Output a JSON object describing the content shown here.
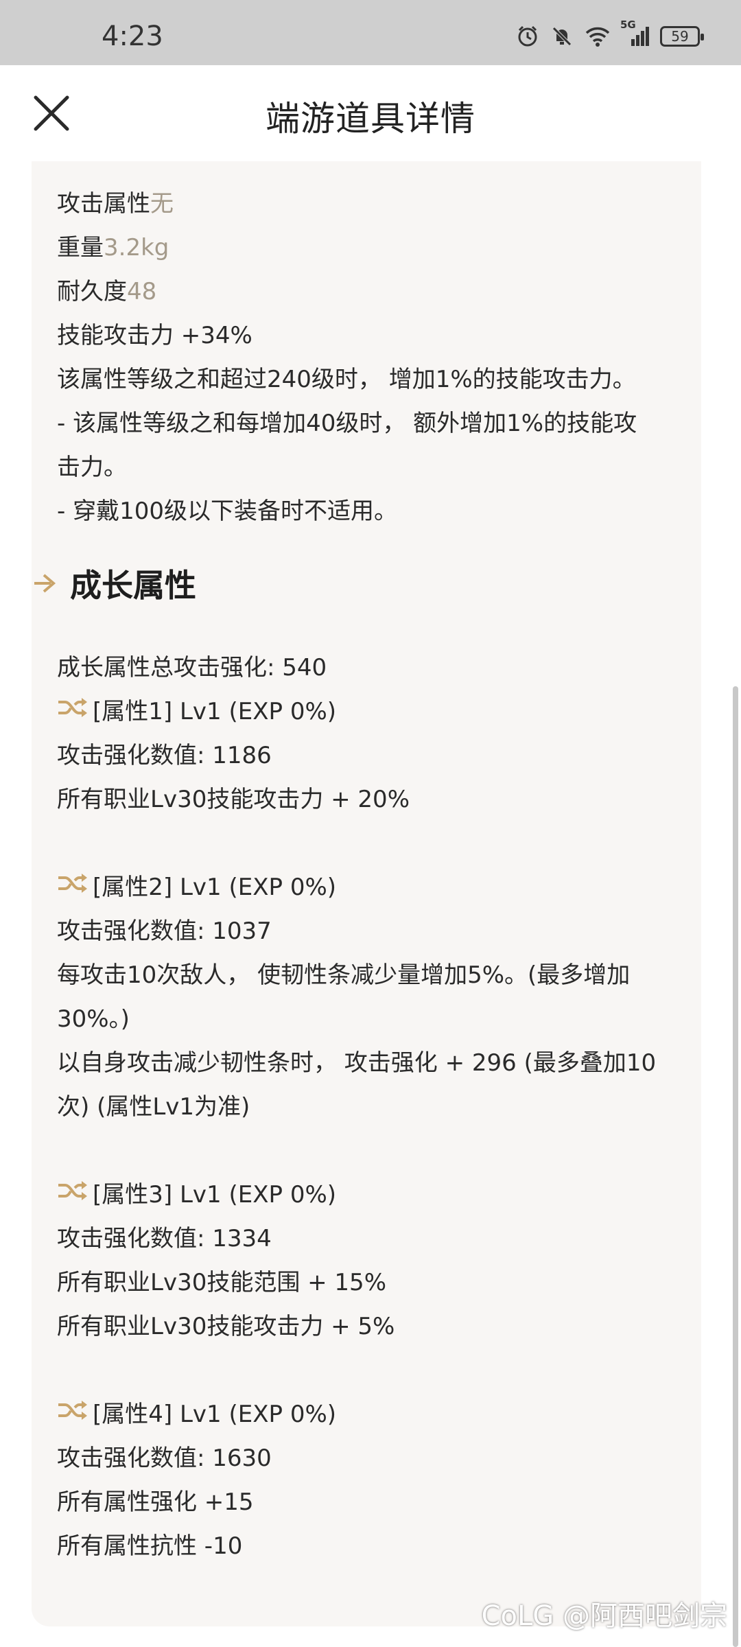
{
  "status_bar": {
    "time": "4:23",
    "network": "5G",
    "battery": "59"
  },
  "header": {
    "title": "端游道具详情"
  },
  "top_card": {
    "lines": [
      {
        "label": "攻击属性",
        "value": "无"
      },
      {
        "label": "重量",
        "value": "3.2kg"
      },
      {
        "label": "耐久度",
        "value": "48"
      },
      {
        "text": "技能攻击力 +34%"
      },
      {
        "text": "该属性等级之和超过240级时， 增加1%的技能攻击力。"
      },
      {
        "text": "- 该属性等级之和每增加40级时， 额外增加1%的技能攻"
      },
      {
        "text": "击力。"
      },
      {
        "text": "- 穿戴100级以下装备时不适用。"
      }
    ]
  },
  "section": {
    "title": "成长属性"
  },
  "growth_card": {
    "total": "成长属性总攻击强化: 540",
    "attributes": [
      {
        "header": "[属性1] Lv1 (EXP 0%)",
        "lines": [
          "攻击强化数值:  1186",
          "所有职业Lv30技能攻击力 + 20%"
        ]
      },
      {
        "header": "[属性2] Lv1 (EXP 0%)",
        "lines": [
          "攻击强化数值:  1037",
          "每攻击10次敌人， 使韧性条减少量增加5%。(最多增加",
          "30%。)",
          "以自身攻击减少韧性条时， 攻击强化 + 296 (最多叠加10",
          "次) (属性Lv1为准)"
        ]
      },
      {
        "header": "[属性3] Lv1 (EXP 0%)",
        "lines": [
          "攻击强化数值:  1334",
          "所有职业Lv30技能范围 + 15%",
          "所有职业Lv30技能攻击力 + 5%"
        ]
      },
      {
        "header": "[属性4] Lv1 (EXP 0%)",
        "lines": [
          "攻击强化数值:  1630",
          "所有属性强化 +15",
          "所有属性抗性 -10"
        ]
      }
    ]
  },
  "watermark": "CoLG @阿西吧剑宗",
  "colors": {
    "muted_value": "#a49a8a",
    "card_bg": "#f8f6f4",
    "accent_gold": "#c9a46a"
  }
}
